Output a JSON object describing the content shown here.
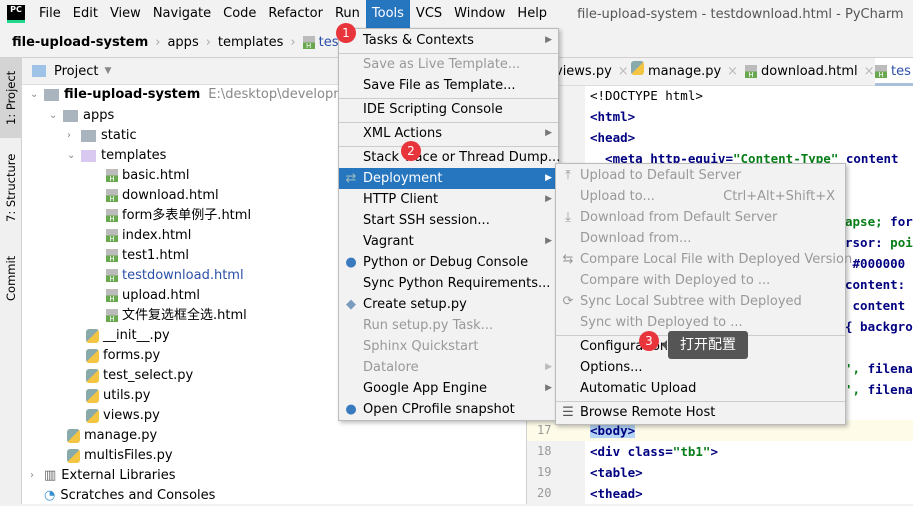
{
  "window_title": "file-upload-system - testdownload.html - PyCharm",
  "menubar": [
    "File",
    "Edit",
    "View",
    "Navigate",
    "Code",
    "Refactor",
    "Run",
    "Tools",
    "VCS",
    "Window",
    "Help"
  ],
  "breadcrumb": [
    "file-upload-system",
    "apps",
    "templates",
    "testdownlo"
  ],
  "tool_strip": [
    "1: Project",
    "7: Structure",
    "Commit"
  ],
  "project": {
    "header": "Project",
    "root": {
      "name": "file-upload-system",
      "path": "E:\\desktop\\development\\f"
    },
    "tree": [
      "apps",
      "static",
      "templates",
      "basic.html",
      "download.html",
      "form多表单例子.html",
      "index.html",
      "test1.html",
      "testdownload.html",
      "upload.html",
      "文件复选框全选.html",
      "__init__.py",
      "forms.py",
      "test_select.py",
      "utils.py",
      "views.py",
      "manage.py",
      "multisFiles.py",
      "External Libraries",
      "Scratches and Consoles"
    ]
  },
  "editor": {
    "tabs": [
      "views.py",
      "manage.py",
      "download.html",
      "tes"
    ],
    "lines": {
      "l1": "<!DOCTYPE html>",
      "l2": "<html>",
      "l3": "<head>",
      "l4a": "  <meta http-equiv=",
      "l4b": "\"Content-Type\"",
      "l4c": " content",
      "l7a": "apse;",
      "l7b": " for",
      "l8a": "rsor:",
      "l8b": " poi",
      "l9": " #000000",
      "l10": "content:",
      "l11": " content",
      "l12": "{ backgro",
      "l14a": "',",
      "l14b": " filena",
      "l15a": "',",
      "l15b": " filena",
      "l17": "<body>",
      "l18a": "<div class=",
      "l18b": "\"tb1\"",
      "l18c": ">",
      "l19": "<table>",
      "l20": "<thead>"
    },
    "line_numbers": [
      "17",
      "18",
      "19",
      "20"
    ]
  },
  "tools_menu": [
    {
      "label": "Tasks & Contexts",
      "submenu": true
    },
    {
      "label": "Save as Live Template...",
      "disabled": true
    },
    {
      "label": "Save File as Template..."
    },
    {
      "label": "IDE Scripting Console"
    },
    {
      "label": "XML Actions",
      "submenu": true
    },
    {
      "label": "Stack Trace or Thread Dump..."
    },
    {
      "label": "Deployment",
      "submenu": true,
      "highlighted": true
    },
    {
      "label": "HTTP Client",
      "submenu": true
    },
    {
      "label": "Start SSH session..."
    },
    {
      "label": "Vagrant",
      "submenu": true
    },
    {
      "label": "Python or Debug Console"
    },
    {
      "label": "Sync Python Requirements..."
    },
    {
      "label": "Create setup.py"
    },
    {
      "label": "Run setup.py Task...",
      "disabled": true
    },
    {
      "label": "Sphinx Quickstart",
      "disabled": true
    },
    {
      "label": "Datalore",
      "disabled": true,
      "submenu": true
    },
    {
      "label": "Google App Engine",
      "submenu": true
    },
    {
      "label": "Open CProfile snapshot"
    }
  ],
  "deployment_menu": [
    {
      "label": "Upload to Default Server",
      "disabled": true
    },
    {
      "label": "Upload to...",
      "disabled": true,
      "shortcut": "Ctrl+Alt+Shift+X"
    },
    {
      "label": "Download from Default Server",
      "disabled": true
    },
    {
      "label": "Download from...",
      "disabled": true
    },
    {
      "label": "Compare Local File with Deployed Version",
      "disabled": true
    },
    {
      "label": "Compare with Deployed to ...",
      "disabled": true
    },
    {
      "label": "Sync Local Subtree with Deployed",
      "disabled": true
    },
    {
      "label": "Sync with Deployed to ...",
      "disabled": true
    },
    {
      "label": "Configuration..."
    },
    {
      "label": "Options..."
    },
    {
      "label": "Automatic Upload"
    },
    {
      "label": "Browse Remote Host"
    }
  ],
  "annotations": {
    "badges": [
      "1",
      "2",
      "3"
    ],
    "tooltip": "打开配置"
  },
  "colors": {
    "highlight": "#2675bf",
    "badge": "#e8353b",
    "tooltip": "#555555"
  }
}
